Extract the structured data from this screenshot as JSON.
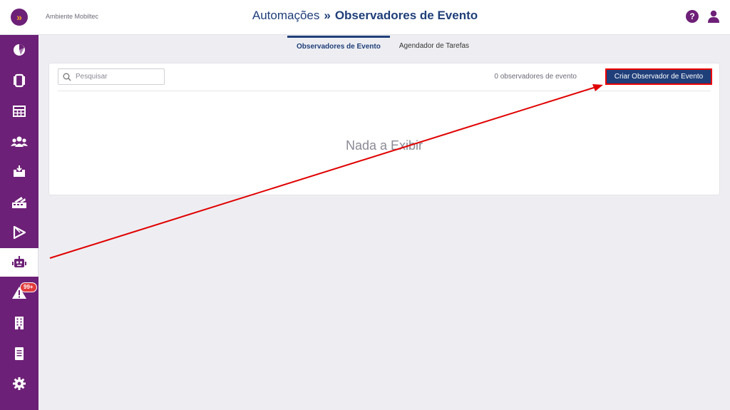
{
  "brand": {
    "logo_glyph": "»",
    "logo_color": "#6d2077",
    "accent": "#f5a623"
  },
  "header": {
    "environment": "Ambiente Mobiltec",
    "breadcrumb_parent": "Automações",
    "breadcrumb_separator": "»",
    "title": "Observadores de Evento",
    "help_glyph": "?"
  },
  "sidebar": {
    "items": [
      {
        "name": "dashboard",
        "icon": "pie-chart-icon"
      },
      {
        "name": "devices",
        "icon": "phone-devices-icon"
      },
      {
        "name": "reports",
        "icon": "table-icon"
      },
      {
        "name": "users",
        "icon": "users-icon"
      },
      {
        "name": "inbox",
        "icon": "inbox-download-icon"
      },
      {
        "name": "apps",
        "icon": "apps-icon"
      },
      {
        "name": "play-store",
        "icon": "play-icon"
      },
      {
        "name": "automations",
        "icon": "robot-icon",
        "active": true
      },
      {
        "name": "alerts",
        "icon": "warning-icon",
        "badge": "99+"
      },
      {
        "name": "buildings",
        "icon": "building-icon"
      },
      {
        "name": "documents",
        "icon": "document-icon"
      },
      {
        "name": "settings",
        "icon": "gear-icon"
      }
    ]
  },
  "tabs": [
    {
      "label": "Observadores de Evento",
      "active": true
    },
    {
      "label": "Agendador de Tarefas",
      "active": false
    }
  ],
  "panel": {
    "search_placeholder": "Pesquisar",
    "count_text": "0 observadores de evento",
    "create_button": "Criar Observador de Evento",
    "empty_text": "Nada a Exibir"
  },
  "colors": {
    "sidebar": "#6d2077",
    "title": "#1f3f7a",
    "annotation": "#e00000",
    "badge": "#e23b3b"
  }
}
